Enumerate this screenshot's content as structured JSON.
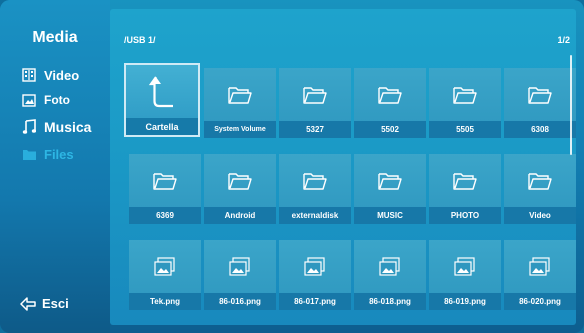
{
  "sidebar": {
    "title": "Media",
    "items": [
      {
        "label": "Video",
        "icon": "video-icon",
        "active": false
      },
      {
        "label": "Foto",
        "icon": "photo-icon",
        "active": false
      },
      {
        "label": "Musica",
        "icon": "music-icon",
        "active": false
      },
      {
        "label": "Files",
        "icon": "folder-icon",
        "active": true
      }
    ],
    "exit_label": "Esci"
  },
  "header": {
    "path": "/USB 1/",
    "page": "1/2"
  },
  "grid": {
    "tiles": [
      {
        "label": "Cartella",
        "type": "up",
        "selected": true
      },
      {
        "label": "System Volume",
        "type": "folder"
      },
      {
        "label": "5327",
        "type": "folder"
      },
      {
        "label": "5502",
        "type": "folder"
      },
      {
        "label": "5505",
        "type": "folder"
      },
      {
        "label": "6308",
        "type": "folder"
      },
      {
        "label": "6369",
        "type": "folder"
      },
      {
        "label": "Android",
        "type": "folder"
      },
      {
        "label": "externaldisk",
        "type": "folder"
      },
      {
        "label": "MUSIC",
        "type": "folder"
      },
      {
        "label": "PHOTO",
        "type": "folder"
      },
      {
        "label": "Video",
        "type": "folder"
      },
      {
        "label": "Tek.png",
        "type": "image"
      },
      {
        "label": "86-016.png",
        "type": "image"
      },
      {
        "label": "86-017.png",
        "type": "image"
      },
      {
        "label": "86-018.png",
        "type": "image"
      },
      {
        "label": "86-019.png",
        "type": "image"
      },
      {
        "label": "86-020.png",
        "type": "image"
      }
    ]
  },
  "colors": {
    "active_menu": "#2db6e4",
    "background": "#127fb3",
    "tile": "#2e97bf",
    "label_bar": "#1778a8"
  }
}
